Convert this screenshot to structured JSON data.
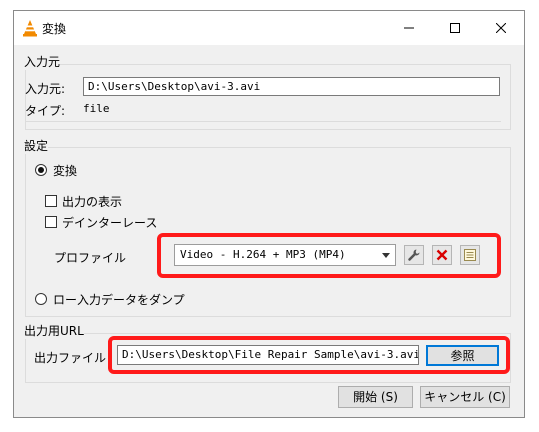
{
  "window": {
    "title": "変換"
  },
  "input_group": {
    "title": "入力元",
    "source_label": "入力元:",
    "source_value": "D:\\Users\\Desktop\\avi-3.avi",
    "type_label": "タイプ:",
    "type_value": "file"
  },
  "settings_group": {
    "title": "設定",
    "convert_label": "変換",
    "convert_selected": true,
    "show_output_label": "出力の表示",
    "deinterlace_label": "デインターレース",
    "profile_label": "プロファイル",
    "profile_value": "Video - H.264 + MP3 (MP4)",
    "dump_label": "ロー入力データをダンプ"
  },
  "output_group": {
    "title": "出力用URL",
    "file_label": "出力ファイル",
    "file_value": "D:\\Users\\Desktop\\File Repair Sample\\avi-3.avi",
    "browse_label": "参照"
  },
  "footer": {
    "start_label": "開始 (S)",
    "cancel_label": "キャンセル (C)"
  },
  "highlight_color": "#ff1a1a"
}
